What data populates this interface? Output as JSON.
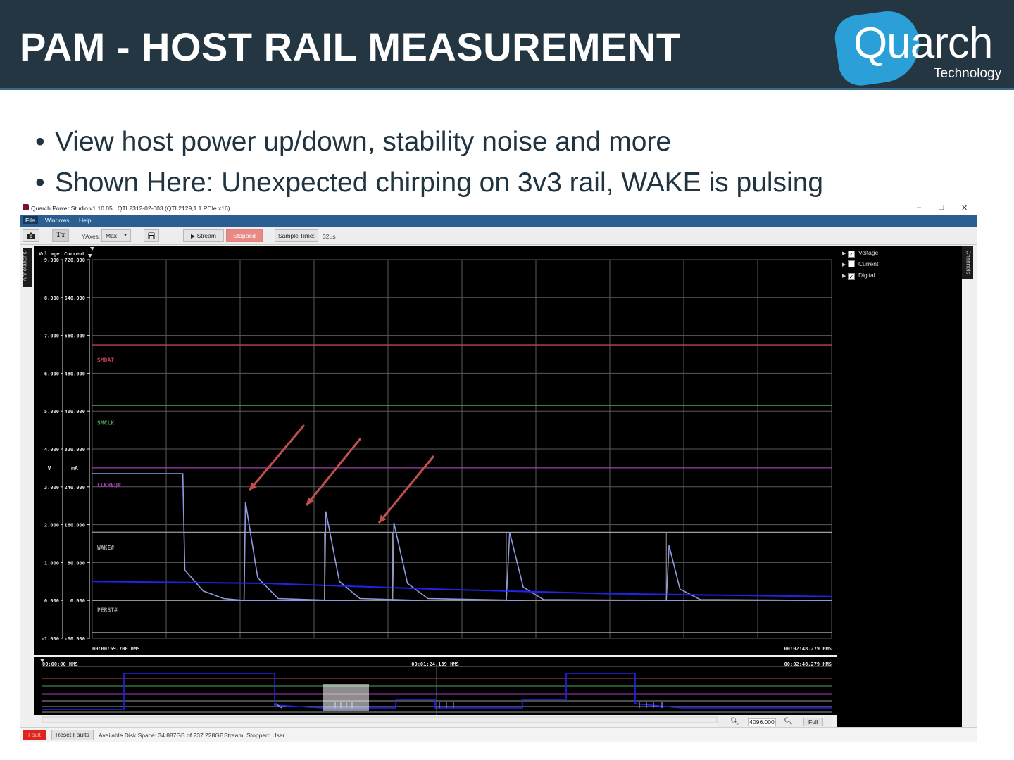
{
  "slide": {
    "title": "PAM - HOST RAIL MEASUREMENT",
    "logo_word": "Quarch",
    "logo_sub": "Technology",
    "bullets": [
      "View host power up/down, stability noise and more",
      "Shown Here: Unexpected chirping on 3v3 rail, WAKE is pulsing"
    ],
    "bullet_glyph": "•"
  },
  "app": {
    "title": "Quarch Power Studio v1.10.05 : QTL2312-02-003 (QTL2129,1.1 PCIe x16)",
    "window_controls": {
      "minimize": "–",
      "restore": "❐",
      "close": "✕"
    },
    "menu": [
      "File",
      "Windows",
      "Help"
    ],
    "toolbar": {
      "camera_icon": "camera-icon",
      "text_button": "Tт",
      "yaxes_label": "YAxes:",
      "yaxes_value": "Max",
      "save_icon": "save-icon",
      "stream_label": "Stream",
      "stopped_label": "Stopped",
      "sample_time_label": "Sample Time:",
      "sample_time_value": "32µs"
    },
    "side_tabs": {
      "annotations": "Annotations",
      "channels": "Channels"
    },
    "channels": [
      {
        "name": "Voltage",
        "checked": true
      },
      {
        "name": "Current",
        "checked": false
      },
      {
        "name": "Digital",
        "checked": true
      }
    ],
    "status": {
      "fault": "Fault",
      "reset_faults": "Reset Faults",
      "disk_space": "Available Disk Space: 34.887GB of 237.228GB",
      "stream": "Stream:  Stopped: User"
    },
    "overview": {
      "start_time": "00:00:00 HMS",
      "mid_time": "00:01:24.139 HMS",
      "end_time": "00:02:48.279 HMS",
      "zoom_value": "4096.000",
      "full_label": "Full"
    },
    "colors": {
      "smdat": "#c0424f",
      "smclk": "#4fa85a",
      "clkreq": "#a23fa8",
      "wake": "#a0a0a0",
      "perst": "#a0a0a0",
      "voltage_trace": "#8e9ae0",
      "current_trace": "#2222ee",
      "arrow": "#c0504d"
    }
  },
  "chart_data": {
    "type": "line",
    "title": "",
    "x_start": "00:00:59.700 HMS",
    "x_end": "00:02:48.279 HMS",
    "xlim": [
      59.7,
      168.279
    ],
    "axes": {
      "voltage": {
        "header": "Voltage",
        "unit": "V",
        "ylim": [
          -1,
          9
        ],
        "ticks": [
          -1,
          0,
          1,
          2,
          3,
          4,
          5,
          6,
          7,
          8,
          9
        ],
        "tick_labels": [
          "-1.000",
          "0.000",
          "1.000",
          "2.000",
          "3.000",
          "4.000",
          "5.000",
          "6.000",
          "7.000",
          "8.000",
          "9.000"
        ]
      },
      "current": {
        "header": "Current",
        "unit": "mA",
        "ylim": [
          -80,
          720
        ],
        "tick_labels": [
          "-80.000",
          "0.000",
          "80.000",
          "160.000",
          "240.000",
          "320.000",
          "400.000",
          "480.000",
          "560.000",
          "640.000",
          "720.000"
        ]
      }
    },
    "grid": true,
    "digital_labels": [
      {
        "name": "SMDAT",
        "color": "#c0424f"
      },
      {
        "name": "SMCLK",
        "color": "#4fa85a"
      },
      {
        "name": "CLKREQ#",
        "color": "#a23fa8"
      },
      {
        "name": "WAKE#",
        "color": "#a0a0a0"
      },
      {
        "name": "PERST#",
        "color": "#a0a0a0"
      }
    ],
    "digital_levels_v": [
      6.75,
      5.15,
      3.5,
      1.8,
      -0.85,
      0.0
    ],
    "series": [
      {
        "name": "Voltage",
        "color": "#8e9ae0",
        "x": [
          59.7,
          73.0,
          73.3,
          76.0,
          79.0,
          82.0,
          85.0,
          90.0,
          80.0,
          82.0,
          82.2,
          84.0,
          87.0,
          95.0,
          98.5,
          90.0,
          93.8,
          94.0,
          96.0,
          99.0,
          108.0,
          103.8,
          104.0,
          106.0,
          109.0,
          123.0,
          120.5,
          121.0,
          123.0,
          126.0,
          147.0,
          144.0,
          144.4,
          146.0,
          149.0,
          168.279
        ],
        "y": [
          3.35,
          3.35,
          0.8,
          0.25,
          0.05,
          0.0,
          0.0,
          0.0,
          0.0,
          0.0,
          2.6,
          0.6,
          0.05,
          0.0,
          0.0,
          0.0,
          0.0,
          2.35,
          0.5,
          0.05,
          0.0,
          0.0,
          2.05,
          0.45,
          0.05,
          0.0,
          0.0,
          1.8,
          0.35,
          0.02,
          0.0,
          0.0,
          1.45,
          0.3,
          0.02,
          0.0
        ]
      },
      {
        "name": "Current",
        "color": "#2222ee",
        "x": [
          59.7,
          85.0,
          110.0,
          135.0,
          168.279
        ],
        "y": [
          0.5,
          0.45,
          0.3,
          0.18,
          0.1
        ]
      }
    ],
    "annotation_arrows": 3
  }
}
